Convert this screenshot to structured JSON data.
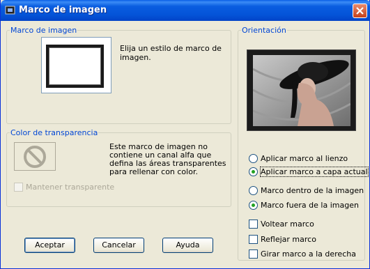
{
  "window": {
    "title": "Marco de imagen"
  },
  "frame_group": {
    "label": "Marco de imagen",
    "description": "Elija un estilo de marco de imagen."
  },
  "transparency_group": {
    "label": "Color de transparencia",
    "description": "Este marco de imagen no contiene un canal alfa que defina las áreas transparentes para rellenar con color.",
    "keep_transparent_label": "Mantener transparente",
    "keep_transparent_checked": false
  },
  "orientation_group": {
    "label": "Orientación",
    "apply_options": [
      {
        "label": "Aplicar marco al lienzo",
        "checked": false
      },
      {
        "label": "Aplicar marco a capa actual",
        "checked": true
      }
    ],
    "position_options": [
      {
        "label": "Marco dentro de la imagen",
        "checked": false
      },
      {
        "label": "Marco fuera de la imagen",
        "checked": true
      }
    ],
    "flip_label": "Voltear marco",
    "mirror_label": "Reflejar marco",
    "rotate_label": "Girar marco a la derecha"
  },
  "buttons": {
    "ok": "Aceptar",
    "cancel": "Cancelar",
    "help": "Ayuda"
  }
}
